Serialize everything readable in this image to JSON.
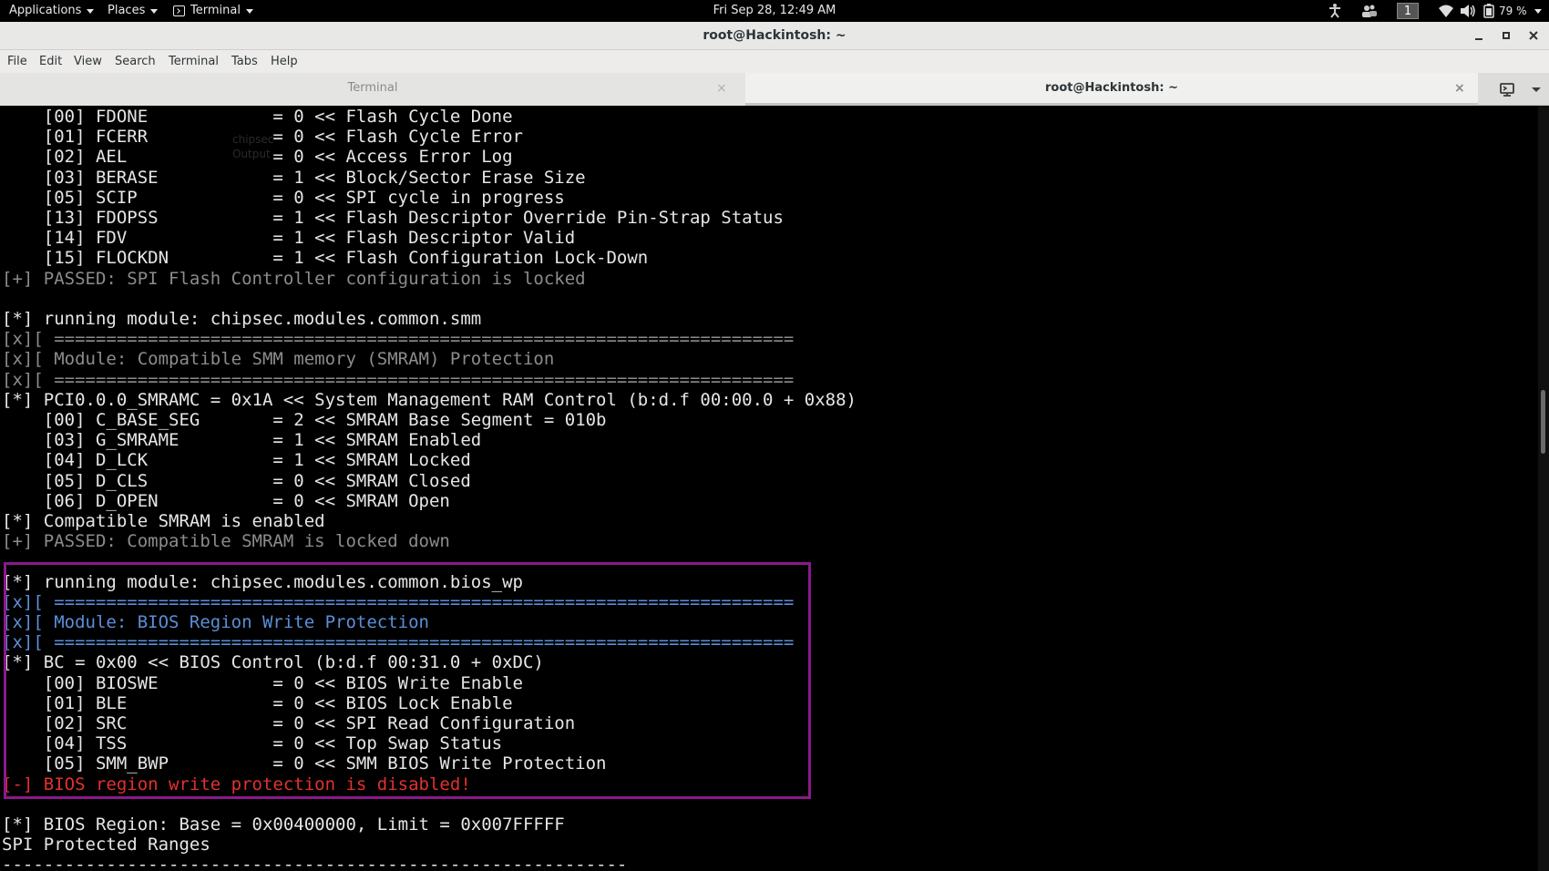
{
  "topbar": {
    "applications": "Applications",
    "places": "Places",
    "terminal": "Terminal",
    "clock": "Fri Sep 28, 12:49 AM",
    "workspace": "1",
    "battery": "79 %"
  },
  "window": {
    "title": "root@Hackintosh: ~"
  },
  "menubar": {
    "items": [
      "File",
      "Edit",
      "View",
      "Search",
      "Terminal",
      "Tabs",
      "Help"
    ]
  },
  "tabs": [
    {
      "label": "Terminal",
      "active": false
    },
    {
      "label": "root@Hackintosh: ~",
      "active": true
    }
  ],
  "ghost": {
    "line1": "chipsec",
    "line2": "Output"
  },
  "terminal": {
    "lines": [
      {
        "text": "    [00] FDONE            = 0 << Flash Cycle Done",
        "style": ""
      },
      {
        "text": "    [01] FCERR            = 0 << Flash Cycle Error",
        "style": ""
      },
      {
        "text": "    [02] AEL              = 0 << Access Error Log",
        "style": ""
      },
      {
        "text": "    [03] BERASE           = 1 << Block/Sector Erase Size",
        "style": ""
      },
      {
        "text": "    [05] SCIP             = 0 << SPI cycle in progress",
        "style": ""
      },
      {
        "text": "    [13] FDOPSS           = 1 << Flash Descriptor Override Pin-Strap Status",
        "style": ""
      },
      {
        "text": "    [14] FDV              = 1 << Flash Descriptor Valid",
        "style": ""
      },
      {
        "text": "    [15] FLOCKDN          = 1 << Flash Configuration Lock-Down",
        "style": ""
      },
      {
        "text": "[+] PASSED: SPI Flash Controller configuration is locked",
        "style": "dim"
      },
      {
        "text": "",
        "style": ""
      },
      {
        "text": "[*] running module: chipsec.modules.common.smm",
        "style": ""
      },
      {
        "text": "[x][ =======================================================================",
        "style": "dim"
      },
      {
        "text": "[x][ Module: Compatible SMM memory (SMRAM) Protection",
        "style": "dim"
      },
      {
        "text": "[x][ =======================================================================",
        "style": "dim"
      },
      {
        "text": "[*] PCI0.0.0_SMRAMC = 0x1A << System Management RAM Control (b:d.f 00:00.0 + 0x88)",
        "style": ""
      },
      {
        "text": "    [00] C_BASE_SEG       = 2 << SMRAM Base Segment = 010b",
        "style": ""
      },
      {
        "text": "    [03] G_SMRAME         = 1 << SMRAM Enabled",
        "style": ""
      },
      {
        "text": "    [04] D_LCK            = 1 << SMRAM Locked",
        "style": ""
      },
      {
        "text": "    [05] D_CLS            = 0 << SMRAM Closed",
        "style": ""
      },
      {
        "text": "    [06] D_OPEN           = 0 << SMRAM Open",
        "style": ""
      },
      {
        "text": "[*] Compatible SMRAM is enabled",
        "style": ""
      },
      {
        "text": "[+] PASSED: Compatible SMRAM is locked down",
        "style": "dim"
      },
      {
        "text": "",
        "style": ""
      },
      {
        "text": "[*] running module: chipsec.modules.common.bios_wp",
        "style": ""
      },
      {
        "text": "[x][ =======================================================================",
        "style": "blue"
      },
      {
        "text": "[x][ Module: BIOS Region Write Protection",
        "style": "blue"
      },
      {
        "text": "[x][ =======================================================================",
        "style": "blue"
      },
      {
        "text": "[*] BC = 0x00 << BIOS Control (b:d.f 00:31.0 + 0xDC)",
        "style": ""
      },
      {
        "text": "    [00] BIOSWE           = 0 << BIOS Write Enable",
        "style": ""
      },
      {
        "text": "    [01] BLE              = 0 << BIOS Lock Enable",
        "style": ""
      },
      {
        "text": "    [02] SRC              = 0 << SPI Read Configuration",
        "style": ""
      },
      {
        "text": "    [04] TSS              = 0 << Top Swap Status",
        "style": ""
      },
      {
        "text": "    [05] SMM_BWP          = 0 << SMM BIOS Write Protection",
        "style": ""
      },
      {
        "text": "[-] BIOS region write protection is disabled!",
        "style": "red"
      },
      {
        "text": "",
        "style": ""
      },
      {
        "text": "[*] BIOS Region: Base = 0x00400000, Limit = 0x007FFFFF",
        "style": ""
      },
      {
        "text": "SPI Protected Ranges",
        "style": ""
      },
      {
        "text": "------------------------------------------------------------",
        "style": ""
      }
    ]
  },
  "colors": {
    "highlight_border": "#8b1a8b",
    "error_text": "#e2312e",
    "module_header": "#5b8fd8"
  }
}
